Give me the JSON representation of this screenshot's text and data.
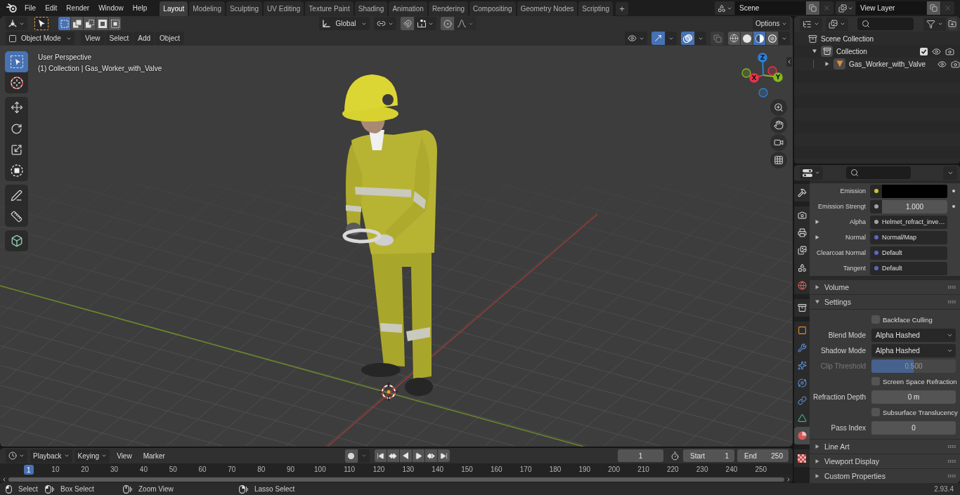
{
  "top_bar": {
    "menus": [
      "File",
      "Edit",
      "Render",
      "Window",
      "Help"
    ],
    "workspaces": [
      {
        "label": "Layout",
        "selected": true
      },
      {
        "label": "Modeling",
        "selected": false
      },
      {
        "label": "Sculpting",
        "selected": false
      },
      {
        "label": "UV Editing",
        "selected": false
      },
      {
        "label": "Texture Paint",
        "selected": false
      },
      {
        "label": "Shading",
        "selected": false
      },
      {
        "label": "Animation",
        "selected": false
      },
      {
        "label": "Rendering",
        "selected": false
      },
      {
        "label": "Compositing",
        "selected": false
      },
      {
        "label": "Geometry Nodes",
        "selected": false
      },
      {
        "label": "Scripting",
        "selected": false
      }
    ],
    "add_workspace": "+",
    "scene": "Scene",
    "view_layer": "View Layer"
  },
  "tool_header": {
    "select_modes": [
      {
        "kind": "set",
        "selected": true
      },
      {
        "kind": "extend",
        "selected": false
      },
      {
        "kind": "subtract",
        "selected": false
      },
      {
        "kind": "invert",
        "selected": false
      },
      {
        "kind": "intersect",
        "selected": false
      }
    ],
    "orientation": "Global",
    "snap_on": false,
    "proportional_on": false,
    "options": "Options"
  },
  "viewport_header": {
    "mode": "Object Mode",
    "menus": [
      "View",
      "Select",
      "Add",
      "Object"
    ],
    "gizmos_on": true,
    "overlays_on": true,
    "xray_on": false,
    "shading_modes": [
      {
        "kind": "wireframe",
        "selected": false
      },
      {
        "kind": "solid",
        "selected": false
      },
      {
        "kind": "material",
        "selected": true
      },
      {
        "kind": "rendered",
        "selected": false
      }
    ]
  },
  "viewport": {
    "info": [
      "User Perspective",
      "(1) Collection | Gas_Worker_with_Valve"
    ],
    "tool_groups": [
      {
        "tools": [
          {
            "kind": "select_box",
            "selected": true
          },
          {
            "kind": "cursor",
            "selected": false
          }
        ]
      },
      {
        "tools": [
          {
            "kind": "move",
            "selected": false
          },
          {
            "kind": "rotate",
            "selected": false
          },
          {
            "kind": "scale",
            "selected": false
          },
          {
            "kind": "transform",
            "selected": false
          }
        ]
      },
      {
        "tools": [
          {
            "kind": "annotate",
            "selected": false
          },
          {
            "kind": "measure",
            "selected": false
          }
        ]
      },
      {
        "tools": [
          {
            "kind": "add_cube",
            "selected": false
          }
        ]
      }
    ],
    "gizmo_axes": [
      {
        "label": "X",
        "color": "#e8334a"
      },
      {
        "label": "Y",
        "color": "#82b91e"
      },
      {
        "label": "Z",
        "color": "#2f7fd6"
      }
    ]
  },
  "outliner": {
    "tree": [
      {
        "label": "Scene Collection",
        "kind": "scene",
        "selected": false,
        "children": [
          {
            "label": "Collection",
            "kind": "collection",
            "selected": false,
            "expanded": true,
            "checked": true,
            "visible": true,
            "renderable": true,
            "children": [
              {
                "label": "Gas_Worker_with_Valve",
                "kind": "object",
                "selected": false,
                "expanded": false,
                "visible": true,
                "renderable": true
              }
            ]
          }
        ]
      }
    ]
  },
  "properties": {
    "tab_groups": [
      {
        "tabs": [
          {
            "kind": "tool",
            "selected": false
          }
        ]
      },
      {
        "tabs": [
          {
            "kind": "render",
            "selected": false
          },
          {
            "kind": "output",
            "selected": false
          },
          {
            "kind": "view_layer",
            "selected": false
          },
          {
            "kind": "scene",
            "selected": false
          },
          {
            "kind": "world",
            "selected": false
          }
        ]
      },
      {
        "tabs": [
          {
            "kind": "collection",
            "selected": false
          }
        ]
      },
      {
        "tabs": [
          {
            "kind": "object",
            "selected": false
          },
          {
            "kind": "modifiers",
            "selected": false
          },
          {
            "kind": "particles",
            "selected": false
          },
          {
            "kind": "physics",
            "selected": false
          },
          {
            "kind": "constraints",
            "selected": false
          },
          {
            "kind": "data",
            "selected": false
          },
          {
            "kind": "material",
            "selected": true
          }
        ]
      },
      {
        "tabs": [
          {
            "kind": "texture",
            "selected": false
          }
        ]
      }
    ],
    "inputs": [
      {
        "label": "Emission",
        "kind": "color",
        "color": "#c7c729",
        "swatch": {
          "color": "#000000"
        },
        "decorator": true
      },
      {
        "label": "Emission Strengt",
        "kind": "number",
        "color": "#a1a1a1",
        "value": "1.000",
        "decorator": true
      },
      {
        "label": "Alpha",
        "kind": "link",
        "expanded": false,
        "color": "#a1a1a1",
        "value": "Helmet_refract_inve…",
        "decorator": false
      },
      {
        "label": "Normal",
        "kind": "link",
        "expanded": false,
        "color": "#6363c7",
        "value": "Normal/Map",
        "decorator": false
      },
      {
        "label": "Clearcoat Normal",
        "kind": "vector",
        "color": "#6363c7",
        "value": "Default",
        "decorator": false
      },
      {
        "label": "Tangent",
        "kind": "vector",
        "color": "#6363c7",
        "value": "Default",
        "decorator": false
      }
    ],
    "panels": [
      {
        "title": "Volume",
        "expanded": false
      },
      {
        "title": "Settings",
        "expanded": true,
        "fields": [
          {
            "kind": "checkbox",
            "label": "Backface Culling",
            "checked": false
          },
          {
            "kind": "dropdown",
            "label": "Blend Mode",
            "value": "Alpha Hashed"
          },
          {
            "kind": "dropdown",
            "label": "Shadow Mode",
            "value": "Alpha Hashed"
          },
          {
            "kind": "slider",
            "label": "Clip Threshold",
            "value": "0.500",
            "level": 0.5,
            "disabled": true
          },
          {
            "kind": "checkbox",
            "label": "Screen Space Refraction",
            "checked": false
          },
          {
            "kind": "number",
            "label": "Refraction Depth",
            "value": "0 m"
          },
          {
            "kind": "checkbox",
            "label": "Subsurface Translucency",
            "checked": false
          },
          {
            "kind": "number",
            "label": "Pass Index",
            "value": "0"
          }
        ]
      },
      {
        "title": "Line Art",
        "expanded": false
      },
      {
        "title": "Viewport Display",
        "expanded": false
      },
      {
        "title": "Custom Properties",
        "expanded": false
      }
    ]
  },
  "timeline": {
    "menus": [
      {
        "label": "Playback",
        "kind": "dropdown"
      },
      {
        "label": "Keying",
        "kind": "dropdown"
      },
      {
        "label": "View",
        "kind": "menu"
      },
      {
        "label": "Marker",
        "kind": "menu"
      }
    ],
    "auto_keying_on": false,
    "current_frame": "1",
    "start": {
      "label": "Start",
      "value": "1"
    },
    "end": {
      "label": "End",
      "value": "250"
    },
    "playhead": "1",
    "frame_labels": [
      "10",
      "20",
      "30",
      "40",
      "50",
      "60",
      "70",
      "80",
      "90",
      "100",
      "110",
      "120",
      "130",
      "140",
      "150",
      "160",
      "170",
      "180",
      "190",
      "200",
      "210",
      "220",
      "230",
      "240",
      "250"
    ]
  },
  "status_bar": {
    "hints": [
      {
        "label": "Select",
        "kind": "left_click"
      },
      {
        "label": "Box Select",
        "kind": "left_drag"
      },
      {
        "label": "Zoom View",
        "kind": "middle_drag"
      },
      {
        "label": "Lasso Select",
        "kind": "right_drag"
      }
    ],
    "version": "2.93.4"
  }
}
